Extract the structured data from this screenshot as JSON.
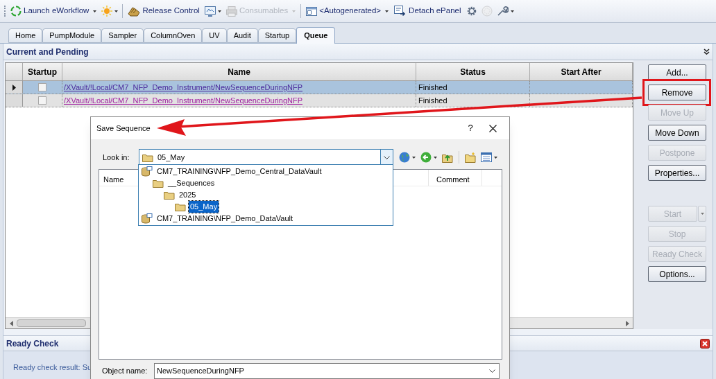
{
  "toolbar": [
    {
      "kind": "text",
      "label": "Launch eWorkflow",
      "dropdown": true,
      "disabled": false
    },
    {
      "kind": "icon",
      "dropdown": true,
      "disabled": false
    },
    {
      "kind": "separator"
    },
    {
      "kind": "text",
      "label": "Release Control",
      "dropdown": false,
      "disabled": false
    },
    {
      "kind": "icon",
      "dropdown": true,
      "disabled": false
    },
    {
      "kind": "text",
      "label": "Consumables",
      "dropdown": true,
      "disabled": true
    },
    {
      "kind": "separator"
    },
    {
      "kind": "text",
      "label": "<Autogenerated>",
      "dropdown": true,
      "disabled": false
    },
    {
      "kind": "text",
      "label": "Detach ePanel",
      "dropdown": false,
      "disabled": false
    },
    {
      "kind": "icon",
      "dropdown": false,
      "disabled": false
    },
    {
      "kind": "icon",
      "dropdown": false,
      "disabled": true
    },
    {
      "kind": "icon",
      "dropdown": true,
      "disabled": false
    }
  ],
  "tabs": [
    {
      "label": "Home",
      "selected": false
    },
    {
      "label": "PumpModule",
      "selected": false
    },
    {
      "label": "Sampler",
      "selected": false
    },
    {
      "label": "ColumnOven",
      "selected": false
    },
    {
      "label": "UV",
      "selected": false
    },
    {
      "label": "Audit",
      "selected": false
    },
    {
      "label": "Startup",
      "selected": false
    },
    {
      "label": "Queue",
      "selected": true
    }
  ],
  "queue_panel": {
    "title": "Current and Pending",
    "table": {
      "columns": [
        "Startup",
        "Name",
        "Status",
        "Start After"
      ],
      "rows": [
        {
          "selected": true,
          "startup_checked": false,
          "name": "/XVault/!Local/CM7_NFP_Demo_Instrument/NewSequenceDuringNFP",
          "status": "Finished"
        },
        {
          "selected": false,
          "startup_checked": false,
          "name": "/XVault/!Local/CM7_NFP_Demo_Instrument/NewSequenceDuringNFP",
          "status": "Finished"
        }
      ]
    },
    "queue_buttons": [
      {
        "label": "Add...",
        "disabled": false,
        "highlighted": false
      },
      {
        "label": "Remove",
        "disabled": false,
        "highlighted": true
      },
      {
        "label": "Move Up",
        "disabled": true,
        "highlighted": false
      },
      {
        "label": "Move Down",
        "disabled": false,
        "highlighted": false
      },
      {
        "label": "Postpone",
        "disabled": true,
        "highlighted": false
      },
      {
        "label": "Properties...",
        "disabled": false,
        "highlighted": false
      }
    ],
    "run_buttons": [
      {
        "label": "Start",
        "disabled": true,
        "dropdown": true
      },
      {
        "label": "Stop",
        "disabled": true,
        "dropdown": false
      },
      {
        "label": "Ready Check",
        "disabled": true,
        "dropdown": false
      },
      {
        "label": "Options...",
        "disabled": false,
        "dropdown": false
      }
    ]
  },
  "ready_check": {
    "title": "Ready Check",
    "result": "Ready check result: Su"
  },
  "annotation_arrow": true,
  "dialog": {
    "title": "Save Sequence",
    "help": "?",
    "look_in_label": "Look in:",
    "look_in_value": "05_May",
    "columns": [
      "Name",
      "Comment"
    ],
    "dropdown_items": [
      {
        "kind": "vault",
        "label": "CM7_TRAINING\\NFP_Demo_Central_DataVault",
        "selected": false,
        "children": [
          {
            "kind": "folder",
            "label": "__Sequences",
            "selected": false,
            "children": [
              {
                "kind": "folder",
                "label": "2025",
                "selected": false,
                "children": [
                  {
                    "kind": "folder",
                    "label": "05_May",
                    "selected": true
                  }
                ]
              }
            ]
          }
        ]
      },
      {
        "kind": "vault",
        "label": "CM7_TRAINING\\NFP_Demo_DataVault",
        "selected": false
      }
    ],
    "object_name_label": "Object name:",
    "object_name": "NewSequenceDuringNFP"
  }
}
